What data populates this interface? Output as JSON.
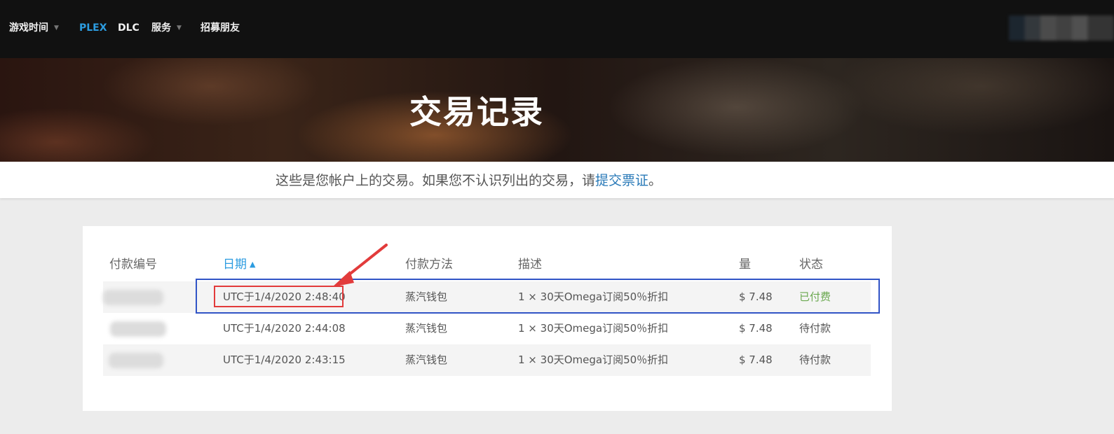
{
  "nav": {
    "items": [
      {
        "label": "游戏时间",
        "has_dropdown": true
      },
      {
        "label": "PLEX",
        "active": true
      },
      {
        "label": "DLC"
      },
      {
        "label": "服务",
        "has_dropdown": true
      },
      {
        "label": "招募朋友"
      }
    ],
    "caret_icon": "▼"
  },
  "hero": {
    "title": "交易记录"
  },
  "info": {
    "prefix": "这些是您帐户上的交易。如果您不认识列出的交易，请",
    "link": "提交票证",
    "suffix": "。"
  },
  "table": {
    "headers": {
      "payment_id": "付款编号",
      "date": "日期",
      "method": "付款方法",
      "description": "描述",
      "amount": "量",
      "status": "状态"
    },
    "sort_icon": "▲",
    "rows": [
      {
        "date": "UTC于1/4/2020 2:48:40",
        "method": "蒸汽钱包",
        "description": "1 × 30天Omega订阅50％折扣",
        "amount": "$ 7.48",
        "status": "已付费"
      },
      {
        "date": "UTC于1/4/2020 2:44:08",
        "method": "蒸汽钱包",
        "description": "1 × 30天Omega订阅50％折扣",
        "amount": "$ 7.48",
        "status": "待付款"
      },
      {
        "date": "UTC于1/4/2020 2:43:15",
        "method": "蒸汽钱包",
        "description": "1 × 30天Omega订阅50％折扣",
        "amount": "$ 7.48",
        "status": "待付款"
      }
    ]
  },
  "colors": {
    "accent": "#2c9ce0",
    "paid": "#6aa84f",
    "highlight_blue": "#3154c6",
    "highlight_red": "#e23b3b"
  }
}
